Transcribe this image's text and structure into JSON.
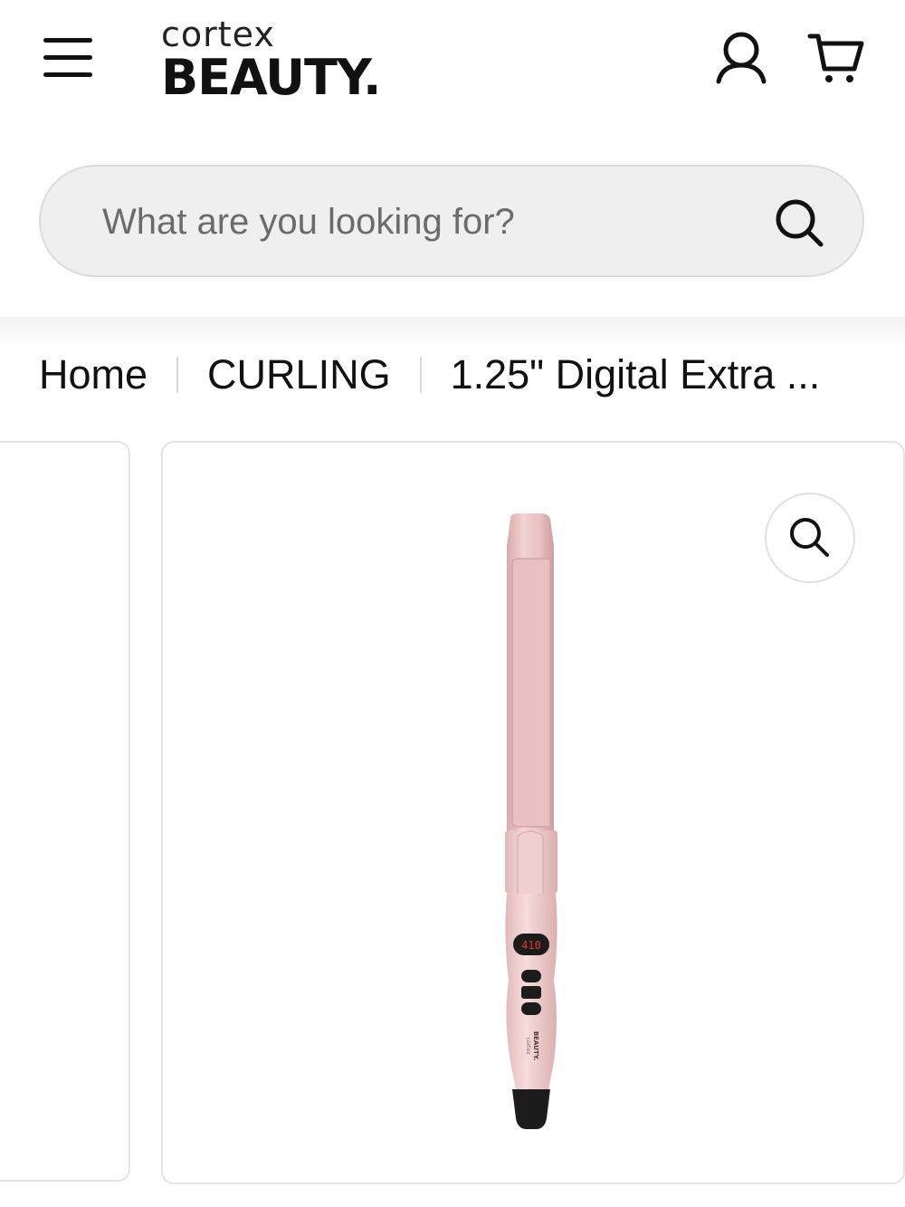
{
  "header": {
    "logo_top": "cortex",
    "logo_bottom": "BEAUTY.",
    "icons": {
      "menu": "hamburger-menu-icon",
      "account": "user-icon",
      "cart": "cart-icon"
    }
  },
  "search": {
    "placeholder": "What are you looking for?",
    "icon": "search-icon"
  },
  "breadcrumb": {
    "items": [
      {
        "label": "Home"
      },
      {
        "label": "CURLING"
      },
      {
        "label": "1.25\" Digital Extra ..."
      }
    ]
  },
  "gallery": {
    "zoom_icon": "zoom-icon",
    "product": {
      "display_reading": "410",
      "handle_brand_top": "cortex",
      "handle_brand_bottom": "BEAUTY.",
      "colors": {
        "barrel": "#e9c3c3",
        "handle": "#f1d2d2",
        "tip": "#1c1c1c",
        "display_text": "#e8342a"
      }
    }
  }
}
